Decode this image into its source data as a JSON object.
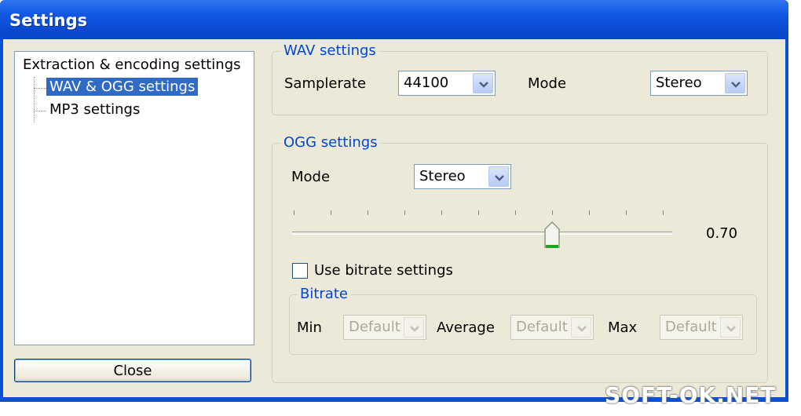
{
  "window": {
    "title": "Settings"
  },
  "tree": {
    "root": "Extraction & encoding settings",
    "items": [
      {
        "label": "WAV & OGG settings",
        "selected": true
      },
      {
        "label": "MP3 settings",
        "selected": false
      }
    ]
  },
  "close_button": "Close",
  "wav": {
    "title": "WAV settings",
    "samplerate_label": "Samplerate",
    "samplerate_value": "44100",
    "mode_label": "Mode",
    "mode_value": "Stereo"
  },
  "ogg": {
    "title": "OGG settings",
    "mode_label": "Mode",
    "mode_value": "Stereo",
    "quality_value": 0.7,
    "quality_text": "0.70",
    "use_bitrate_label": "Use bitrate settings",
    "use_bitrate_checked": false,
    "bitrate": {
      "title": "Bitrate",
      "min_label": "Min",
      "min_value": "Default",
      "average_label": "Average",
      "average_value": "Default",
      "max_label": "Max",
      "max_value": "Default"
    }
  },
  "watermark": "SOFT-OK.NET",
  "colors": {
    "titlebar": "#0a4fd8",
    "selection": "#316ac5",
    "group_title": "#0046d5"
  }
}
